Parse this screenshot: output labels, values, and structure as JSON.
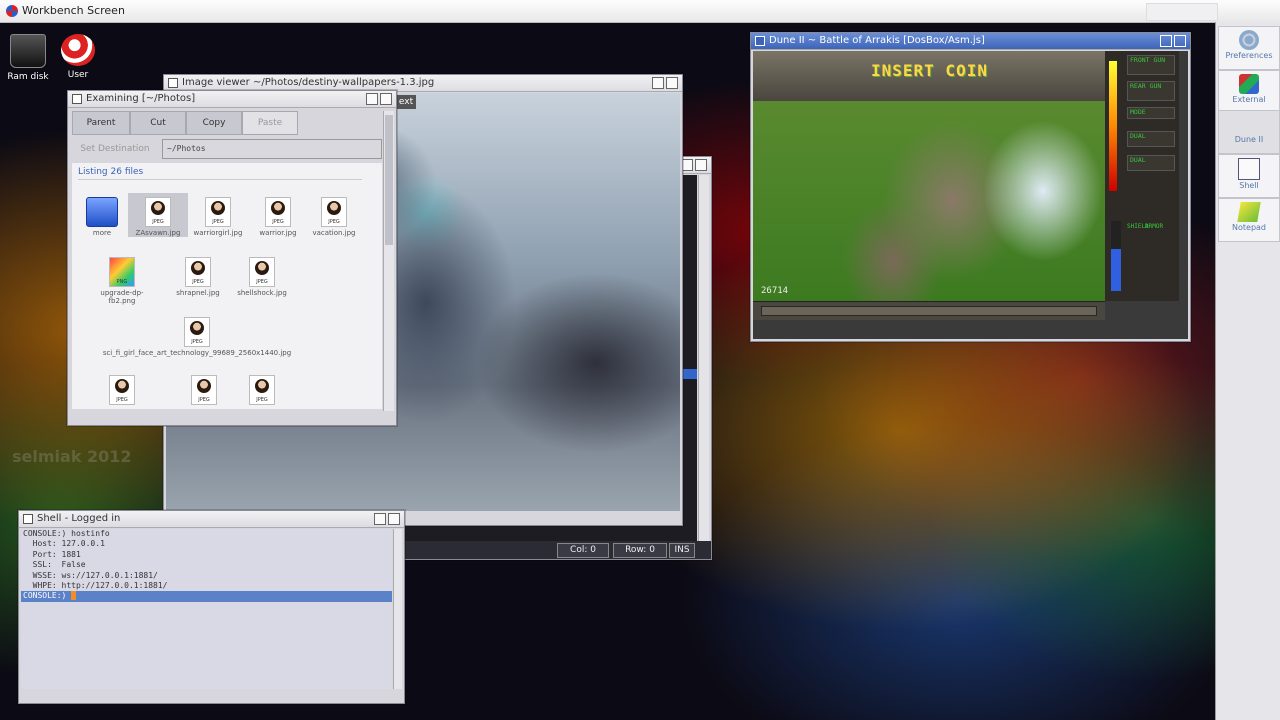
{
  "screen": {
    "title": "Workbench Screen"
  },
  "desktop": {
    "icons": [
      {
        "label": "Ram disk"
      },
      {
        "label": "User"
      }
    ],
    "watermark": "selmiak 2012"
  },
  "image_viewer": {
    "title": "Image viewer ~/Photos/destiny-wallpapers-1.3.jpg",
    "tab_hint": "ext"
  },
  "text_editor": {
    "status": {
      "col": "Col: 0",
      "row": "Row: 0",
      "mode": "INS"
    }
  },
  "file_browser": {
    "title": "Examining [~/Photos]",
    "buttons": {
      "parent": "Parent",
      "cut": "Cut",
      "copy": "Copy",
      "paste": "Paste"
    },
    "set_destination_label": "Set Destination",
    "destination_value": "~/Photos",
    "listing_label": "Listing 26 files",
    "files": [
      {
        "name": "more",
        "type": "folder"
      },
      {
        "name": "ZAsvawn.jpg",
        "type": "jpeg",
        "ext": "JPEG"
      },
      {
        "name": "warriorgirl.jpg",
        "type": "jpeg",
        "ext": "JPEG"
      },
      {
        "name": "warrior.jpg",
        "type": "jpeg",
        "ext": "JPEG"
      },
      {
        "name": "vacation.jpg",
        "type": "jpeg",
        "ext": "JPEG"
      },
      {
        "name": "upgrade-dp-fb2.png",
        "type": "png",
        "ext": "PNG"
      },
      {
        "name": "shrapnel.jpg",
        "type": "jpeg",
        "ext": "JPEG"
      },
      {
        "name": "shellshock.jpg",
        "type": "jpeg",
        "ext": "JPEG"
      },
      {
        "name": "sci_fi_girl_face_art_technology_99689_2560x1440.jpg",
        "type": "jpeg",
        "ext": "JPEG"
      },
      {
        "name": "",
        "type": "jpeg",
        "ext": "JPEG"
      },
      {
        "name": "",
        "type": "jpeg",
        "ext": "JPEG"
      },
      {
        "name": "",
        "type": "jpeg",
        "ext": "JPEG"
      }
    ]
  },
  "shell": {
    "title": "Shell - Logged in",
    "lines": [
      "CONSOLE:) hostinfo",
      "  Host: 127.0.0.1",
      "  Port: 1881",
      "  SSL:  False",
      "  WSSE: ws://127.0.0.1:1881/",
      "  WHPE: http://127.0.0.1:1881/"
    ],
    "prompt": "CONSOLE:)"
  },
  "dune": {
    "title": "Dune II ~ Battle of Arrakis [DosBox/Asm.js]",
    "insert_coin": "INSERT COIN",
    "score": "26714",
    "hud": [
      "FRONT GUN",
      "REAR GUN",
      "MODE",
      "DUAL",
      "DUAL"
    ],
    "vertical_labels": [
      "SHIELD",
      "ARMOR"
    ]
  },
  "dock": {
    "items": [
      {
        "label": "Preferences",
        "icon": "preferences-icon"
      },
      {
        "label": "External",
        "icon": "external-icon"
      },
      {
        "label": "Dune II",
        "icon": ""
      },
      {
        "label": "Shell",
        "icon": "shell-icon"
      },
      {
        "label": "Notepad",
        "icon": "notepad-icon"
      }
    ]
  }
}
